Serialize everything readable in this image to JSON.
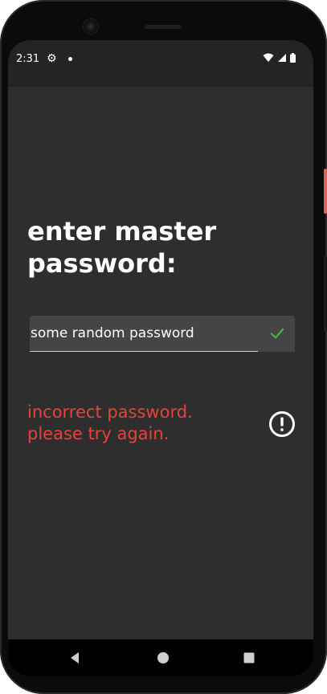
{
  "status_bar": {
    "time": "2:31",
    "icons": [
      "gear-icon",
      "notification-dot",
      "wifi-icon",
      "cellular-icon",
      "battery-icon"
    ]
  },
  "main": {
    "title": "enter master password:",
    "password_field": {
      "value": "some random password",
      "valid_icon": "check-icon"
    },
    "error": {
      "message": "incorrect password. please try again.",
      "icon": "alert-circle-icon"
    }
  },
  "nav_bar": {
    "buttons": [
      "back-icon",
      "home-icon",
      "recents-icon"
    ]
  },
  "colors": {
    "background": "#2e2e2e",
    "status_bar": "#242424",
    "field": "#454545",
    "error": "#e2453a",
    "check": "#4caf50",
    "text": "#ffffff"
  }
}
